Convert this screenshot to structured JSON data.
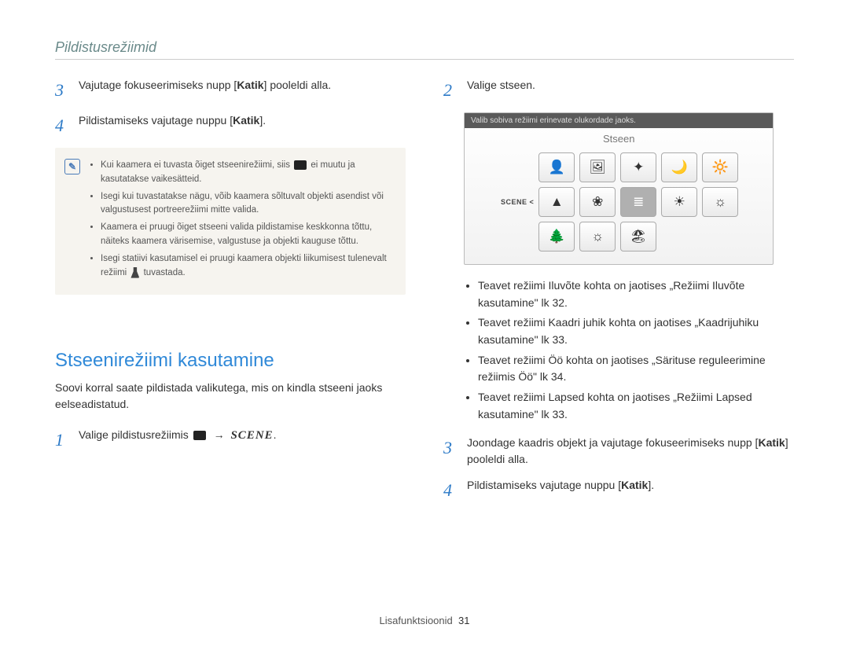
{
  "header": {
    "title": "Pildistusrežiimid"
  },
  "left": {
    "steps": {
      "s3": {
        "num": "3",
        "text_a": "Vajutage fokuseerimiseks nupp [",
        "bold": "Katik",
        "text_b": "] pooleldi alla."
      },
      "s4": {
        "num": "4",
        "text_a": "Pildistamiseks vajutage nuppu [",
        "bold": "Katik",
        "text_b": "]."
      }
    },
    "notes": {
      "n1a": "Kui kaamera ei tuvasta õiget stseenirežiimi, siis ",
      "n1b": " ei muutu ja kasutatakse vaikesätteid.",
      "n2": "Isegi kui tuvastatakse nägu, võib kaamera sõltuvalt objekti asendist või valgustusest portreerežiimi mitte valida.",
      "n3": "Kaamera ei pruugi õiget stseeni valida pildistamise keskkonna tõttu, näiteks kaamera värisemise, valgustuse ja objekti kauguse tõttu.",
      "n4a": "Isegi statiivi kasutamisel ei pruugi kaamera objekti liikumisest tulenevalt režiimi ",
      "n4b": " tuvastada."
    },
    "section": {
      "title": "Stseenirežiimi kasutamine",
      "intro": "Soovi korral saate pildistada valikutega, mis on kindla stseeni jaoks eelseadistatud.",
      "step1": {
        "num": "1",
        "text": "Valige pildistusrežiimis ",
        "arrow": "→",
        "scene": "SCENE",
        "dot": "."
      }
    }
  },
  "right": {
    "step2": {
      "num": "2",
      "text": "Valige stseen."
    },
    "screenshot": {
      "bar": "Valib sobiva režiimi erinevate olukordade jaoks.",
      "title": "Stseen",
      "side": "SCENE <",
      "icons": {
        "r1": [
          "👤",
          "🖼",
          "✦",
          "🌙",
          "🔆"
        ],
        "r2": [
          "▲",
          "❀",
          "≣",
          "☀",
          "☼"
        ],
        "r3": [
          "🌲",
          "☼",
          "🏖",
          "",
          ""
        ]
      }
    },
    "bullets": {
      "b1": "Teavet režiimi Iluvõte kohta on jaotises „Režiimi Iluvõte kasutamine\" lk 32.",
      "b2": "Teavet režiimi Kaadri juhik kohta on jaotises „Kaadrijuhiku kasutamine\" lk 33.",
      "b3": "Teavet režiimi Öö kohta on jaotises „Särituse reguleerimine režiimis Öö\" lk 34.",
      "b4": "Teavet režiimi Lapsed kohta on jaotises „Režiimi Lapsed kasutamine\" lk 33."
    },
    "step3": {
      "num": "3",
      "text_a": "Joondage kaadris objekt ja vajutage fokuseerimiseks nupp [",
      "bold": "Katik",
      "text_b": "] pooleldi alla."
    },
    "step4": {
      "num": "4",
      "text_a": "Pildistamiseks vajutage nuppu [",
      "bold": "Katik",
      "text_b": "]."
    }
  },
  "footer": {
    "label": "Lisafunktsioonid",
    "page": "31"
  }
}
